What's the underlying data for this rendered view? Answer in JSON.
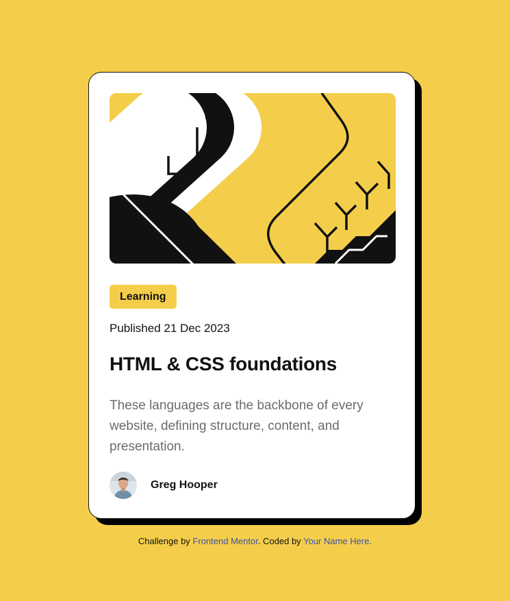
{
  "card": {
    "tag": "Learning",
    "published": "Published 21 Dec 2023",
    "title": "HTML & CSS foundations",
    "description": "These languages are the backbone of every website, defining structure, content, and presentation.",
    "author": {
      "name": "Greg Hooper"
    }
  },
  "attribution": {
    "prefix": "Challenge by ",
    "link1": "Frontend Mentor",
    "middle": ". Coded by ",
    "link2": "Your Name Here",
    "suffix": "."
  },
  "colors": {
    "background": "#F4CE4B",
    "card": "#FFFFFF",
    "text": "#111111",
    "muted": "#6B6B6B",
    "link": "#3E52A3"
  },
  "icons": {
    "hero": "geometric-illustration",
    "avatar": "greg-hooper-avatar"
  }
}
